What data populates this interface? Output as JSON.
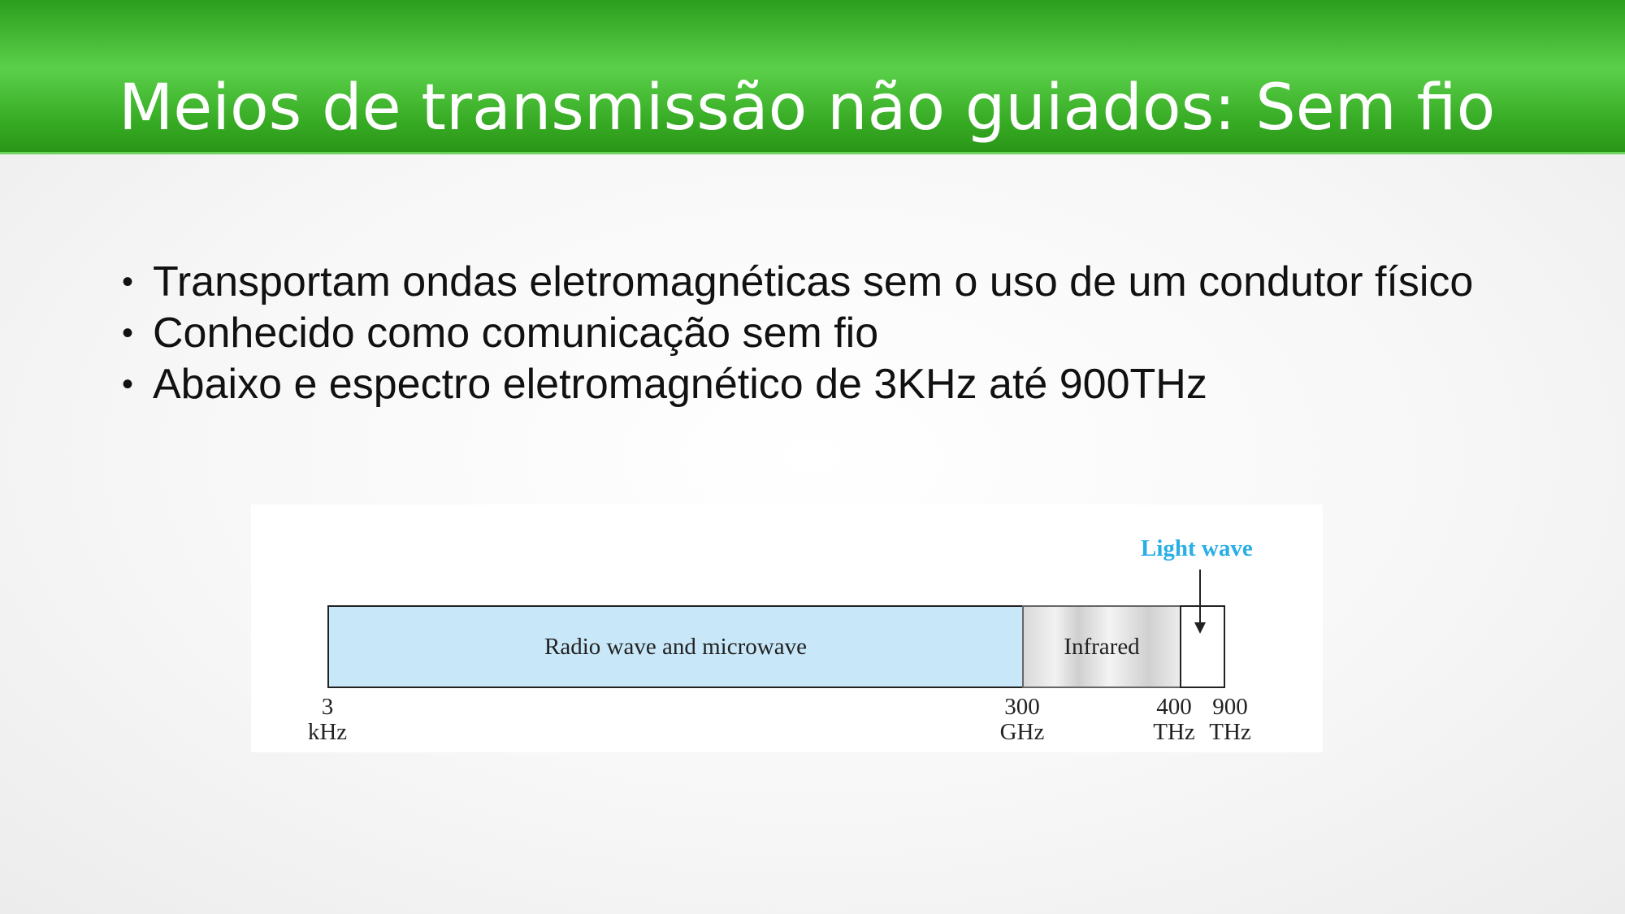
{
  "slide": {
    "title": "Meios de transmissão não guiados: Sem fio",
    "bullets": [
      "Transportam ondas eletromagnéticas sem o uso de um condutor físico",
      "Conhecido como comunicação sem fio",
      "Abaixo e espectro eletromagnético de 3KHz até 900THz"
    ],
    "bullet_char": "•"
  },
  "figure": {
    "segments": [
      "Radio wave and microwave",
      "Infrared"
    ],
    "light_wave_label": "Light wave",
    "ticks": [
      {
        "value": "3",
        "unit": "kHz"
      },
      {
        "value": "300",
        "unit": "GHz"
      },
      {
        "value": "400",
        "unit": "THz"
      },
      {
        "value": "900",
        "unit": "THz"
      }
    ],
    "colors": {
      "radio": "#c8e8f9",
      "light_label": "#29aee6",
      "header": "#37ab24"
    }
  }
}
